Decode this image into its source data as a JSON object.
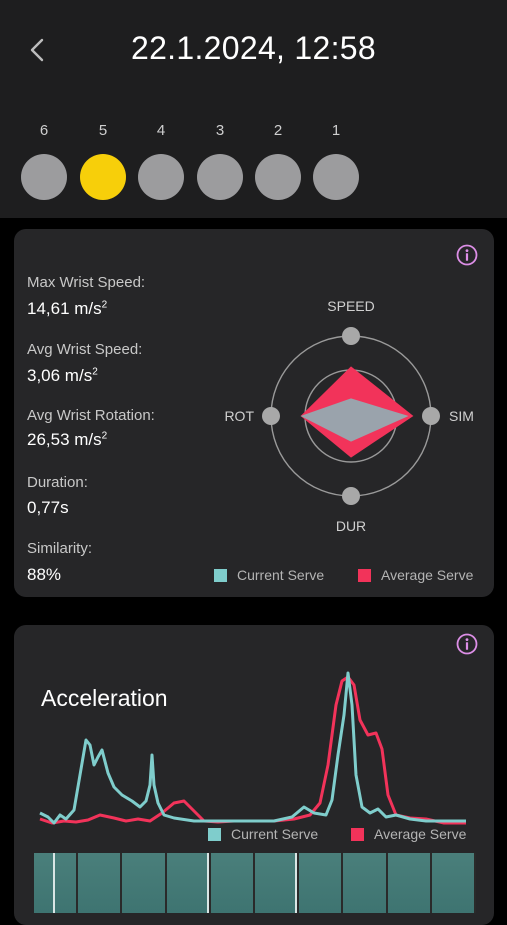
{
  "header": {
    "title": "22.1.2024, 12:58",
    "shots": [
      {
        "label": "6",
        "active": false
      },
      {
        "label": "5",
        "active": true
      },
      {
        "label": "4",
        "active": false
      },
      {
        "label": "3",
        "active": false
      },
      {
        "label": "2",
        "active": false
      },
      {
        "label": "1",
        "active": false
      }
    ]
  },
  "stats": {
    "max_wrist_speed": {
      "label": "Max Wrist Speed:",
      "value": "14,61 m/s",
      "unit_sup": "2"
    },
    "avg_wrist_speed": {
      "label": "Avg Wrist Speed:",
      "value": "3,06 m/s",
      "unit_sup": "2"
    },
    "avg_wrist_rotation": {
      "label": "Avg Wrist Rotation:",
      "value": "26,53 m/s",
      "unit_sup": "2"
    },
    "duration": {
      "label": "Duration:",
      "value": "0,77s"
    },
    "similarity": {
      "label": "Similarity:",
      "value": "88%"
    }
  },
  "radar": {
    "axes": [
      "SPEED",
      "SIM",
      "DUR",
      "ROT"
    ],
    "current_serve": [
      0.22,
      0.72,
      0.32,
      0.63
    ],
    "average_serve": [
      0.62,
      0.78,
      0.52,
      0.63
    ],
    "legend": {
      "current": "Current Serve",
      "average": "Average Serve"
    }
  },
  "acceleration": {
    "title": "Acceleration",
    "legend": {
      "current": "Current Serve",
      "average": "Average Serve"
    }
  },
  "colors": {
    "current": "#7fcdcc",
    "average": "#f2335a",
    "active_shot": "#f7cf0a",
    "info": "#dc8ee6"
  },
  "icons": {
    "back": "chevron-left-icon",
    "info": "info-circle-icon"
  }
}
